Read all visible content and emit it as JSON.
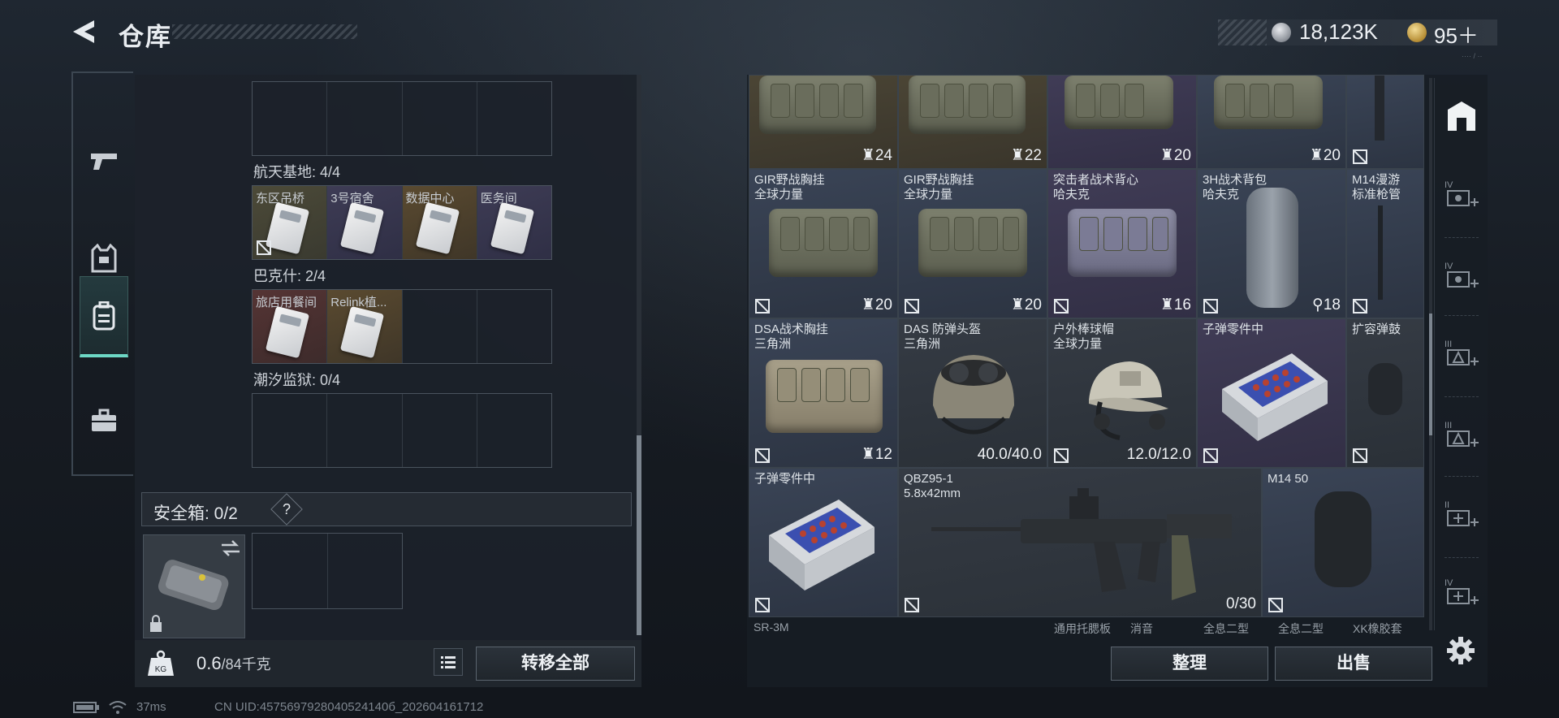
{
  "header": {
    "title": "仓库",
    "currency_silver": "18,123K",
    "currency_gold": "95＋"
  },
  "left_nav": {
    "items": [
      "weapons-tab",
      "equipment-tab",
      "backpack-tab",
      "briefcase-tab"
    ],
    "active": "backpack-tab"
  },
  "key_sections": [
    {
      "label": "航天基地: 4/4",
      "cells": [
        {
          "label": "东区吊桥",
          "color": "olive"
        },
        {
          "label": "3号宿舍",
          "color": "purple"
        },
        {
          "label": "数据中心",
          "color": "gold"
        },
        {
          "label": "医务间",
          "color": "purple"
        }
      ]
    },
    {
      "label": "巴克什: 2/4",
      "cells": [
        {
          "label": "旅店用餐间",
          "color": "red"
        },
        {
          "label": "Relink植...",
          "color": "gold"
        }
      ]
    },
    {
      "label": "潮汐监狱: 0/4",
      "cells": []
    }
  ],
  "safebox": {
    "label": "安全箱: 0/2",
    "help": "?"
  },
  "left_footer": {
    "weight_value": "0.6",
    "weight_unit": "/84千克",
    "transfer_all": "转移全部"
  },
  "stash_items": [
    {
      "name_line1": "",
      "name_line2": "",
      "qty": "24"
    },
    {
      "name_line1": "",
      "name_line2": "",
      "qty": "22"
    },
    {
      "name_line1": "",
      "name_line2": "",
      "qty": "20"
    },
    {
      "name_line1": "",
      "name_line2": "",
      "qty": "20"
    },
    {
      "name_line1": "GIR野战胸挂",
      "name_line2": "全球力量",
      "qty": "20"
    },
    {
      "name_line1": "GIR野战胸挂",
      "name_line2": "全球力量",
      "qty": "20"
    },
    {
      "name_line1": "突击者战术背心",
      "name_line2": "哈夫克",
      "qty": "16"
    },
    {
      "name_line1": "3H战术背包",
      "name_line2": "哈夫克",
      "qty": "18"
    },
    {
      "name_line1": "M14漫游",
      "name_line2": "标准枪管",
      "qty": ""
    },
    {
      "name_line1": "DSA战术胸挂",
      "name_line2": "三角洲",
      "qty": "12"
    },
    {
      "name_line1": "DAS 防弹头盔",
      "name_line2": "三角洲",
      "qty": "40.0/40.0"
    },
    {
      "name_line1": "户外棒球帽",
      "name_line2": "全球力量",
      "qty": "12.0/12.0"
    },
    {
      "name_line1": "子弹零件中",
      "name_line2": "",
      "qty": ""
    },
    {
      "name_line1": "扩容弹鼓",
      "name_line2": "",
      "qty": ""
    },
    {
      "name_line1": "子弹零件中",
      "name_line2": "",
      "qty": ""
    },
    {
      "name_line1": "QBZ95-1",
      "name_line2": "5.8x42mm",
      "qty": "0/30"
    },
    {
      "name_line1": "M14 50",
      "name_line2": "",
      "qty": ""
    }
  ],
  "stash_bottom_labels": [
    "SR-3M",
    "通用托腮板",
    "消音",
    "全息二型",
    "全息二型",
    "XK橡胶套"
  ],
  "right_footer": {
    "sort": "整理",
    "sell": "出售"
  },
  "side_tools": [
    "stash-home-icon",
    "expand-case-iv-icon",
    "expand-case-iv-icon",
    "expand-case-iii-icon",
    "expand-case-iii-icon",
    "expand-case-ii-icon",
    "expand-case-iv-icon",
    "settings-gear-icon"
  ],
  "statusbar": {
    "ping": "37ms",
    "uid": "CN UID:4575697928040524140б_202604161712"
  },
  "colors": {
    "accent_teal": "#6dd8c5",
    "panel_bg": "#1c222a"
  }
}
